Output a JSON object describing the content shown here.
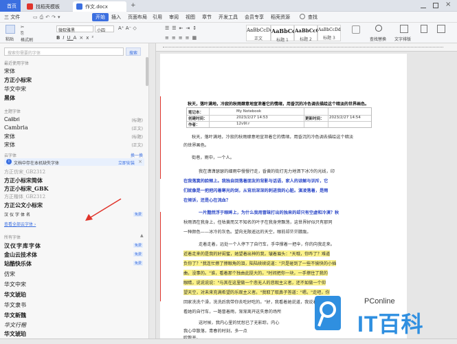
{
  "tabs": {
    "home": "首页",
    "template": "找稻壳模板",
    "doc": "作文.docx",
    "add": "+"
  },
  "menu": {
    "file": "三 文件",
    "start": "开始",
    "items": [
      "插入",
      "页面布局",
      "引用",
      "审阅",
      "视图",
      "章节",
      "开发工具",
      "会员专享",
      "稻壳资源"
    ],
    "search": "查找"
  },
  "ribbon": {
    "paste": "粘贴",
    "format_painter": "格式刷",
    "font_name": "微软雅黑",
    "font_size": "小四",
    "styles": [
      {
        "preview": "AaBbCcDd",
        "name": "正文"
      },
      {
        "preview": "AaBbCc",
        "name": "标题 1"
      },
      {
        "preview": "AaBbCcC",
        "name": "标题 2"
      },
      {
        "preview": "AaBbCcDd",
        "name": "标题 3"
      }
    ],
    "find_replace": "查找替换",
    "text_layout": "文字排版"
  },
  "sidebar": {
    "search_placeholder": "搜索你需要的字体",
    "search_button": "搜索",
    "recent_header": "最近使用字体",
    "recent_fonts": [
      "宋体",
      "方正小标宋",
      "华文中宋",
      "黑体"
    ],
    "theme_header": "主题字体",
    "theme_fonts": [
      {
        "name": "Calibri",
        "role": "(标题)"
      },
      {
        "name": "Cambria",
        "role": "(正文)"
      },
      {
        "name": "宋体",
        "role": "(标题)"
      },
      {
        "name": "宋体",
        "role": "(正文)"
      }
    ],
    "cloud_header": "云字体",
    "cloud_switch": "换一换",
    "notice_text": "文档中存在本机缺失字体",
    "notice_action": "立即安装",
    "cloud_fonts": [
      {
        "name": "方正仿宋_GB2312",
        "badge": ""
      },
      {
        "name": "方正小标宋简体",
        "badge": ""
      },
      {
        "name": "方正小标宋_GBK",
        "badge": ""
      },
      {
        "name": "方正楷体_GB2312",
        "badge": ""
      },
      {
        "name": "方正公文小标宋",
        "badge": ""
      },
      {
        "name": "汉仪字体名",
        "badge": "免费"
      }
    ],
    "view_all": "查看全部云字体 ›",
    "all_header": "所有字体",
    "all_fonts": [
      {
        "name": "汉仪字库字体",
        "badge": "免费"
      },
      {
        "name": "金山云技术体",
        "badge": "免费"
      },
      {
        "name": "站酷快乐体",
        "badge": "免费"
      },
      {
        "name": "仿宋",
        "badge": ""
      },
      {
        "name": "华文中宋",
        "badge": ""
      },
      {
        "name": "华文琥珀",
        "badge": ""
      },
      {
        "name": "华文隶书",
        "badge": ""
      },
      {
        "name": "华文新魏",
        "badge": ""
      },
      {
        "name": "华文行楷",
        "badge": ""
      },
      {
        "name": "华文琥珀",
        "badge": ""
      },
      {
        "name": "华文隶书",
        "badge": ""
      }
    ]
  },
  "document": {
    "title": "秋天，落叶满地，冷寂的秋雨肆意地宣泄着它的情绪，用昏沉的冷色调去描绘这个暗淡的世界画色。",
    "table": {
      "r1": [
        "笔记本：",
        "My Notebook",
        "",
        ""
      ],
      "r2": [
        "创建时间：",
        "2023/2/27 14:53",
        "更新时间：",
        "2023/2/27 14:54"
      ],
      "r3": [
        "作者：",
        "12v9l:r",
        "",
        ""
      ]
    },
    "paragraphs": [
      {
        "text": "秋天，落叶满地，冷寂的秋雨肆意地宣泄着它的情绪，用昏沉的冷色调去描绘这个暗淡",
        "style": ""
      },
      {
        "text": "的世界画色。",
        "style": ""
      },
      {
        "text": "街巷，雨中，一个人。",
        "style": ""
      },
      {
        "text": "我在潇潇瑟瑟的细雨中慢慢行走，昏黄的街灯无力地洒下冰冷的光线，印",
        "style": ""
      },
      {
        "text": "在我落寞的脸颊上。我独自回落着朋友的背影与话语，家人的谅解与训斥，它",
        "style": "blue"
      },
      {
        "text": "们就像是一把把闪着寒光的剑，从背后深深的刺进我的心脏。演凌落着，是雨",
        "style": "blue"
      },
      {
        "text": "在倾诉，还是心在流血？",
        "style": "blue"
      },
      {
        "text": "一片黯然浮于眼眸上，为什么我用冒昧打出的独来的却只有空虚和冷漠？秋",
        "style": "blue"
      },
      {
        "text": "秋雨洒在我身上，任枯黄而又不知名的叶子在我身旁飘荡，这世界好似只有那同",
        "style": ""
      },
      {
        "text": "一种颜色——冰冷的灰色。望向无限遥远的天空，眼前却茫茫朦胧。",
        "style": ""
      },
      {
        "text": "走着走着，远处一个人停下了自行车，手中撑着一把伞，你的向我走来。",
        "style": ""
      },
      {
        "text": "近着走来的是我的好闺蜜，她望着出神的我，皱着眉头：\"天哦，你咋了？难道",
        "style": "hl"
      },
      {
        "text": "负你了？\"我连忙擦了擦眼角的泪，陆陆续续说道：\"只是碰到了一些不愉快的小插",
        "style": "hl"
      },
      {
        "text": "曲，没事的。\"谁，看着那个独由此挺大的，\"时间把你一块，一手擦住了我的",
        "style": "hl"
      },
      {
        "text": "眼睛，说说说说：\"与其在这里做一个悲无人的悲观主义者，还不如做一个仰",
        "style": "hl"
      },
      {
        "text": "望天空，对未来充满希望的乐观主义者。\"我取了取鼻子答道：\"嗯。\"走吧，你",
        "style": "hl"
      },
      {
        "text": "回家洗洗个澡，洗洗后我带你去吃好吃的。\"好，我看着她说道，我说着我跟上",
        "style": ""
      },
      {
        "text": "看她的自行车，一路冒着雨，渐渐离开这失意的场所",
        "style": ""
      },
      {
        "text": "这时候，我内心里的忧愁已了无影踪，内心",
        "style": ""
      },
      {
        "text": "我心中散落，青春的时刻，多一点",
        "style": ""
      },
      {
        "text": "吹散开。",
        "style": ""
      }
    ]
  },
  "watermark": {
    "brand": "PConline",
    "name": "IT百科"
  },
  "colors": {
    "accent": "#3b6fe0",
    "highlight": "#fbf28a",
    "blue_text": "#2d49c8",
    "annotation": "#e0342b"
  }
}
